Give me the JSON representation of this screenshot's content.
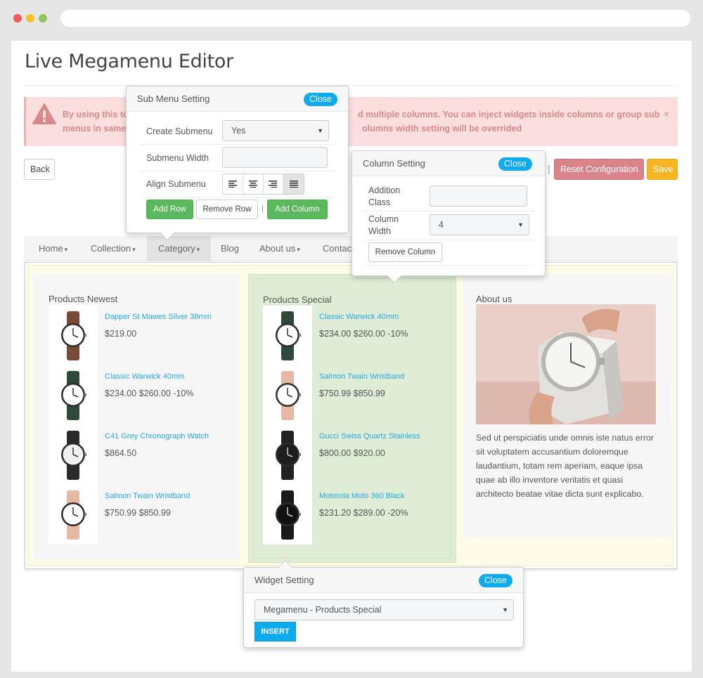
{
  "page_title": "Live Megamenu Editor",
  "alert": {
    "line1_left": "By using this to",
    "line1_right": "d multiple columns. You can inject widgets inside columns or group sub",
    "line2_left": "menus in same",
    "line2_right": "olumns width setting will be overrided",
    "close": "×"
  },
  "toolbar": {
    "back": "Back",
    "separator": "|",
    "reset": "Reset Configuration",
    "save": "Save"
  },
  "nav": [
    {
      "label": "Home",
      "caret": true
    },
    {
      "label": "Collection",
      "caret": true
    },
    {
      "label": "Category",
      "caret": true,
      "active": true
    },
    {
      "label": "Blog",
      "caret": false
    },
    {
      "label": "About us",
      "caret": true
    },
    {
      "label": "Contact",
      "caret": false
    }
  ],
  "caret_char": "▾",
  "columns": {
    "newest": {
      "title": "Products Newest",
      "products": [
        {
          "name": "Dapper St Mawes Silver 38mm",
          "price": "$219.00",
          "strap": "#7a4b34",
          "face": "#ffffff"
        },
        {
          "name": "Classic Warwick 40mm",
          "price": "$234.00 $260.00 -10%",
          "strap": "#2d4a3b",
          "face": "#ffffff"
        },
        {
          "name": "C41 Grey Chronograph Watch",
          "price": "$864.50",
          "strap": "#2a2a2a",
          "face": "#f0f0f0"
        },
        {
          "name": "Salmon Twain Wristband",
          "price": "$750.99 $850.99",
          "strap": "#e7b9a4",
          "face": "#ffffff"
        }
      ]
    },
    "special": {
      "title": "Products Special",
      "products": [
        {
          "name": "Classic Warwick 40mm",
          "price": "$234.00 $260.00 -10%",
          "strap": "#2d4a3b",
          "face": "#ffffff"
        },
        {
          "name": "Salmon Twain Wristband",
          "price": "$750.99 $850.99",
          "strap": "#e7b9a4",
          "face": "#ffffff"
        },
        {
          "name": "Gucci Swiss Quartz Stainless",
          "price": "$800.00 $920.00",
          "strap": "#222222",
          "face": "#1e1e1e"
        },
        {
          "name": "Motorola Moto 360 Black",
          "price": "$231.20 $289.00 -20%",
          "strap": "#1a1a1a",
          "face": "#111111"
        }
      ]
    },
    "about": {
      "title": "About us",
      "text": "Sed ut perspiciatis unde omnis iste natus error sit voluptatem accusantium doloremque laudantium, totam rem aperiam, eaque ipsa quae ab illo inventore veritatis et quasi architecto beatae vitae dicta sunt explicabo."
    }
  },
  "submenu_popup": {
    "title": "Sub Menu Setting",
    "close": "Close",
    "create_label": "Create Submenu",
    "create_value": "Yes",
    "width_label": "Submenu Width",
    "width_value": "",
    "align_label": "Align Submenu",
    "add_row": "Add Row",
    "remove_row": "Remove Row",
    "separator": "|",
    "add_column": "Add Column"
  },
  "column_popup": {
    "title": "Column Setting",
    "close": "Close",
    "class_label_1": "Addition",
    "class_label_2": "Class",
    "class_value": "",
    "width_label_1": "Column",
    "width_label_2": "Width",
    "width_value": "4",
    "remove": "Remove Column"
  },
  "widget_popup": {
    "title": "Widget Setting",
    "close": "Close",
    "select_value": "Megamenu - Products Special",
    "insert": "INSERT"
  },
  "colors": {
    "accent_blue": "#0eaaee",
    "green": "#5cb85c",
    "reset": "#d9838a",
    "save": "#f6b626",
    "alert_bg": "#fbdede",
    "alert_text": "#d98989"
  }
}
